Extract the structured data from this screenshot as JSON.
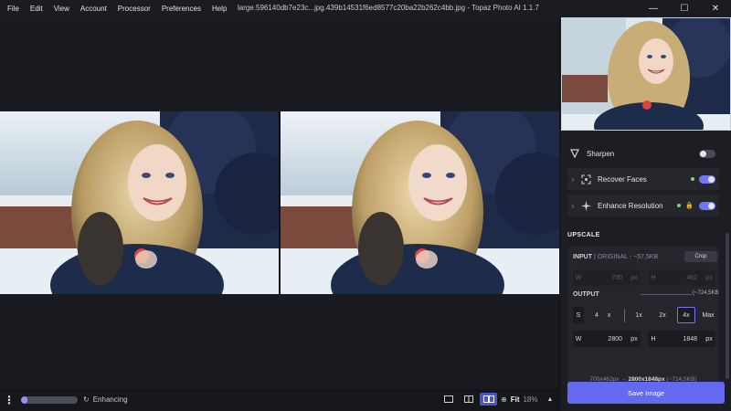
{
  "menu": [
    "File",
    "Edit",
    "View",
    "Account",
    "Processor",
    "Preferences",
    "Help"
  ],
  "window_title": "large.596140db7e23c...jpg.439b14531f6ed8577c20ba22b262c4bb.jpg - Topaz Photo AI 1.1.7",
  "window_controls": {
    "minimize": "—",
    "maximize": "☐",
    "close": "✕"
  },
  "bottom": {
    "menu_icon": "⋮",
    "progress_fraction": 0.12,
    "status_icon": "↻",
    "status": "Enhancing",
    "fit_label": "Fit",
    "zoom": "18%",
    "zoom_icon": "⊕",
    "zoom_arrow": "▲"
  },
  "tools": [
    {
      "label": "Sharpen",
      "on": false,
      "expandable": false,
      "dot": false
    },
    {
      "label": "Recover Faces",
      "on": true,
      "expandable": true,
      "dot": true
    },
    {
      "label": "Enhance Resolution",
      "on": true,
      "expandable": true,
      "dot": true,
      "lock": true
    }
  ],
  "tool_glyphs": {
    "chevron": "›",
    "lock": "🔒"
  },
  "upscale": {
    "title": "UPSCALE",
    "input_label": "INPUT",
    "input_sub": "| ORIGINAL - ~57,5KB",
    "crop_label": "Crop",
    "input_w_label": "W",
    "input_w": "700",
    "input_w_unit": "px",
    "input_h_label": "H",
    "input_h": "462",
    "input_h_unit": "px",
    "output_label": "OUTPUT",
    "output_size": "(~724,5KB",
    "scale_label": "S",
    "scale_value": "4",
    "scale_unit": "x",
    "scale_options": [
      "1x",
      "2x",
      "4x",
      "Max"
    ],
    "scale_selected": "4x",
    "out_w_label": "W",
    "out_w": "2800",
    "out_w_unit": "px",
    "out_h_label": "H",
    "out_h": "1848",
    "out_h_unit": "px",
    "summary_from": "700x462px → ",
    "summary_to": "2800x1848px",
    "summary_size": " (~724,5KB)"
  },
  "save_label": "Save Image",
  "colors": {
    "accent": "#636af0",
    "toggle_on": "#6f77f5",
    "active_dot": "#79d680"
  }
}
